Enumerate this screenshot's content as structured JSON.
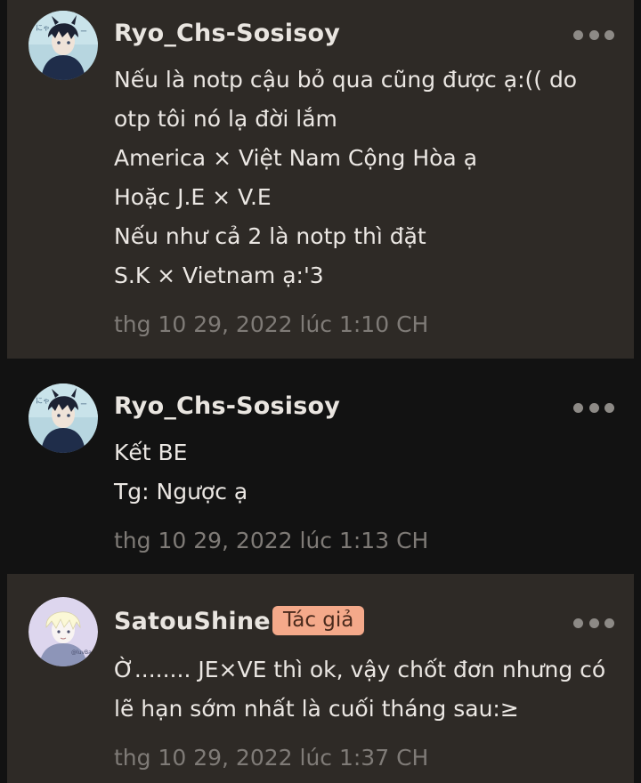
{
  "comments": [
    {
      "username": "Ryo_Chs-Sosisoy",
      "lines": [
        "Nếu là notp cậu bỏ qua cũng được ạ:(( do",
        "otp tôi nó lạ đời lắm",
        "America × Việt Nam Cộng Hòa ạ",
        "Hoặc J.E × V.E",
        "Nếu như cả 2 là notp thì đặt",
        "S.K × Vietnam ạ:'3"
      ],
      "time": "thg 10 29, 2022 lúc 1:10 CH"
    },
    {
      "username": "Ryo_Chs-Sosisoy",
      "lines": [
        "Kết BE",
        "Tg: Ngược ạ"
      ],
      "time": "thg 10 29, 2022 lúc 1:13 CH"
    },
    {
      "username": "SatouShine",
      "badge": "Tác giả",
      "lines": [
        "Ờ........ JE×VE thì ok, vậy chốt đơn nhưng có",
        "lẽ hạn sớm nhất là cuối tháng sau:≥"
      ],
      "time": "thg 10 29, 2022 lúc 1:37 CH"
    }
  ],
  "colors": {
    "background": "#121212",
    "card_highlight": "#2e2a26",
    "badge_bg": "#f4a98a",
    "text": "#ebe7e3",
    "muted": "#7f7b77"
  },
  "icons": {
    "more": "more-horizontal-icon"
  }
}
